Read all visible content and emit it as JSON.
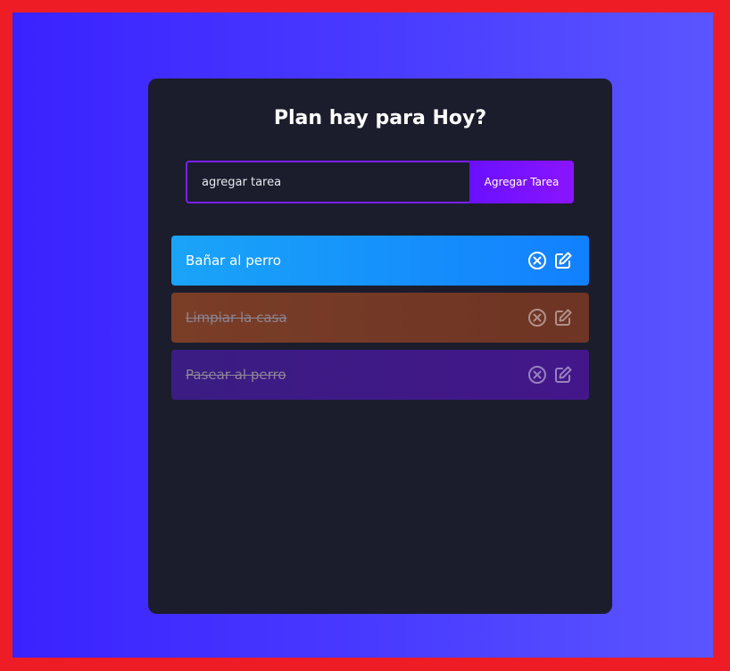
{
  "app": {
    "title": "Plan hay para Hoy?"
  },
  "form": {
    "input_placeholder": "agregar tarea",
    "add_button_label": "Agregar Tarea"
  },
  "todos": [
    {
      "text": "Bañar al perro",
      "completed": false,
      "color": "#1aa4f8"
    },
    {
      "text": "Limpiar la casa",
      "completed": true,
      "color": "#7a3e27"
    },
    {
      "text": "Pasear al perro",
      "completed": true,
      "color": "#3a1c82"
    }
  ],
  "icons": {
    "delete": "close-circle-icon",
    "edit": "edit-icon"
  },
  "colors": {
    "frame": "#ee1c25",
    "background_start": "#3a22ff",
    "background_end": "#5a55ff",
    "panel": "#1b1d2c",
    "accent": "#7a1fff"
  }
}
